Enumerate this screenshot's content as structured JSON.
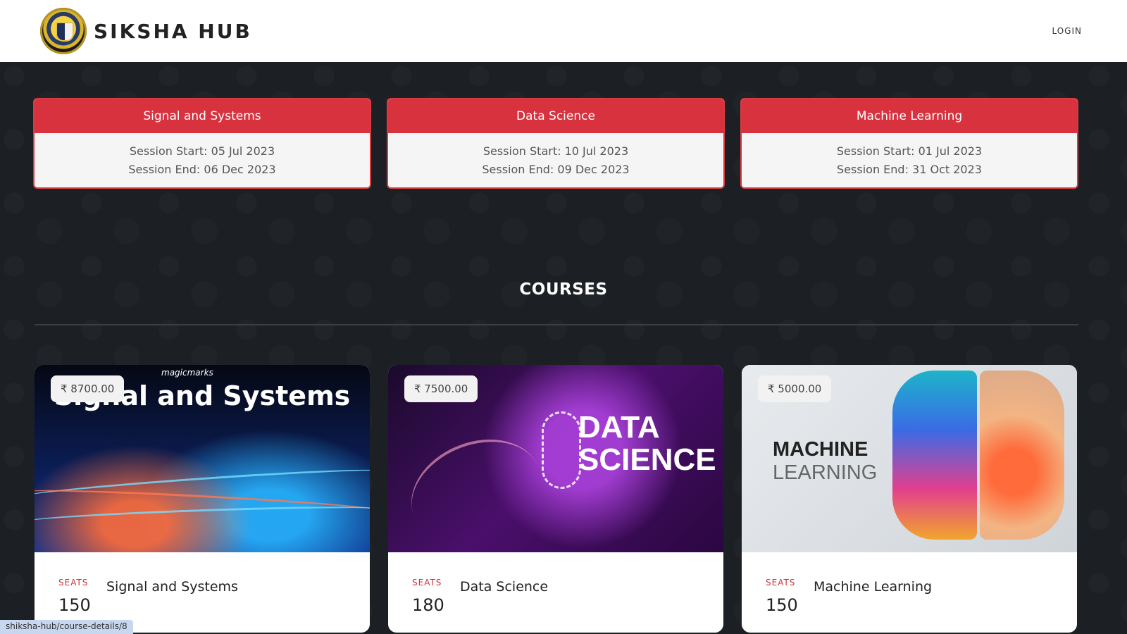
{
  "header": {
    "brand_name": "SIKSHA HUB",
    "login_label": "LOGIN"
  },
  "sessions": [
    {
      "title": "Signal and Systems",
      "start": "Session Start: 05 Jul 2023",
      "end": "Session End: 06 Dec 2023"
    },
    {
      "title": "Data Science",
      "start": "Session Start: 10 Jul 2023",
      "end": "Session End: 09 Dec 2023"
    },
    {
      "title": "Machine Learning",
      "start": "Session Start: 01 Jul 2023",
      "end": "Session End: 31 Oct 2023"
    }
  ],
  "courses_heading": "COURSES",
  "courses": [
    {
      "price": "₹ 8700.00",
      "seats_label": "SEATS",
      "seats": "150",
      "name": "Signal and Systems",
      "image_text": "Signal and Systems",
      "image_caption": "magicmarks"
    },
    {
      "price": "₹ 7500.00",
      "seats_label": "SEATS",
      "seats": "180",
      "name": "Data Science",
      "image_text_line1": "DATA",
      "image_text_line2": "SCIENCE"
    },
    {
      "price": "₹ 5000.00",
      "seats_label": "SEATS",
      "seats": "150",
      "name": "Machine Learning",
      "image_text_line1": "MACHINE",
      "image_text_line2": "LEARNING"
    }
  ],
  "status_bar": {
    "url": "shiksha-hub/course-details/8"
  },
  "colors": {
    "accent_red": "#d8323f",
    "background": "#1c2024",
    "header_bg": "#ffffff"
  }
}
